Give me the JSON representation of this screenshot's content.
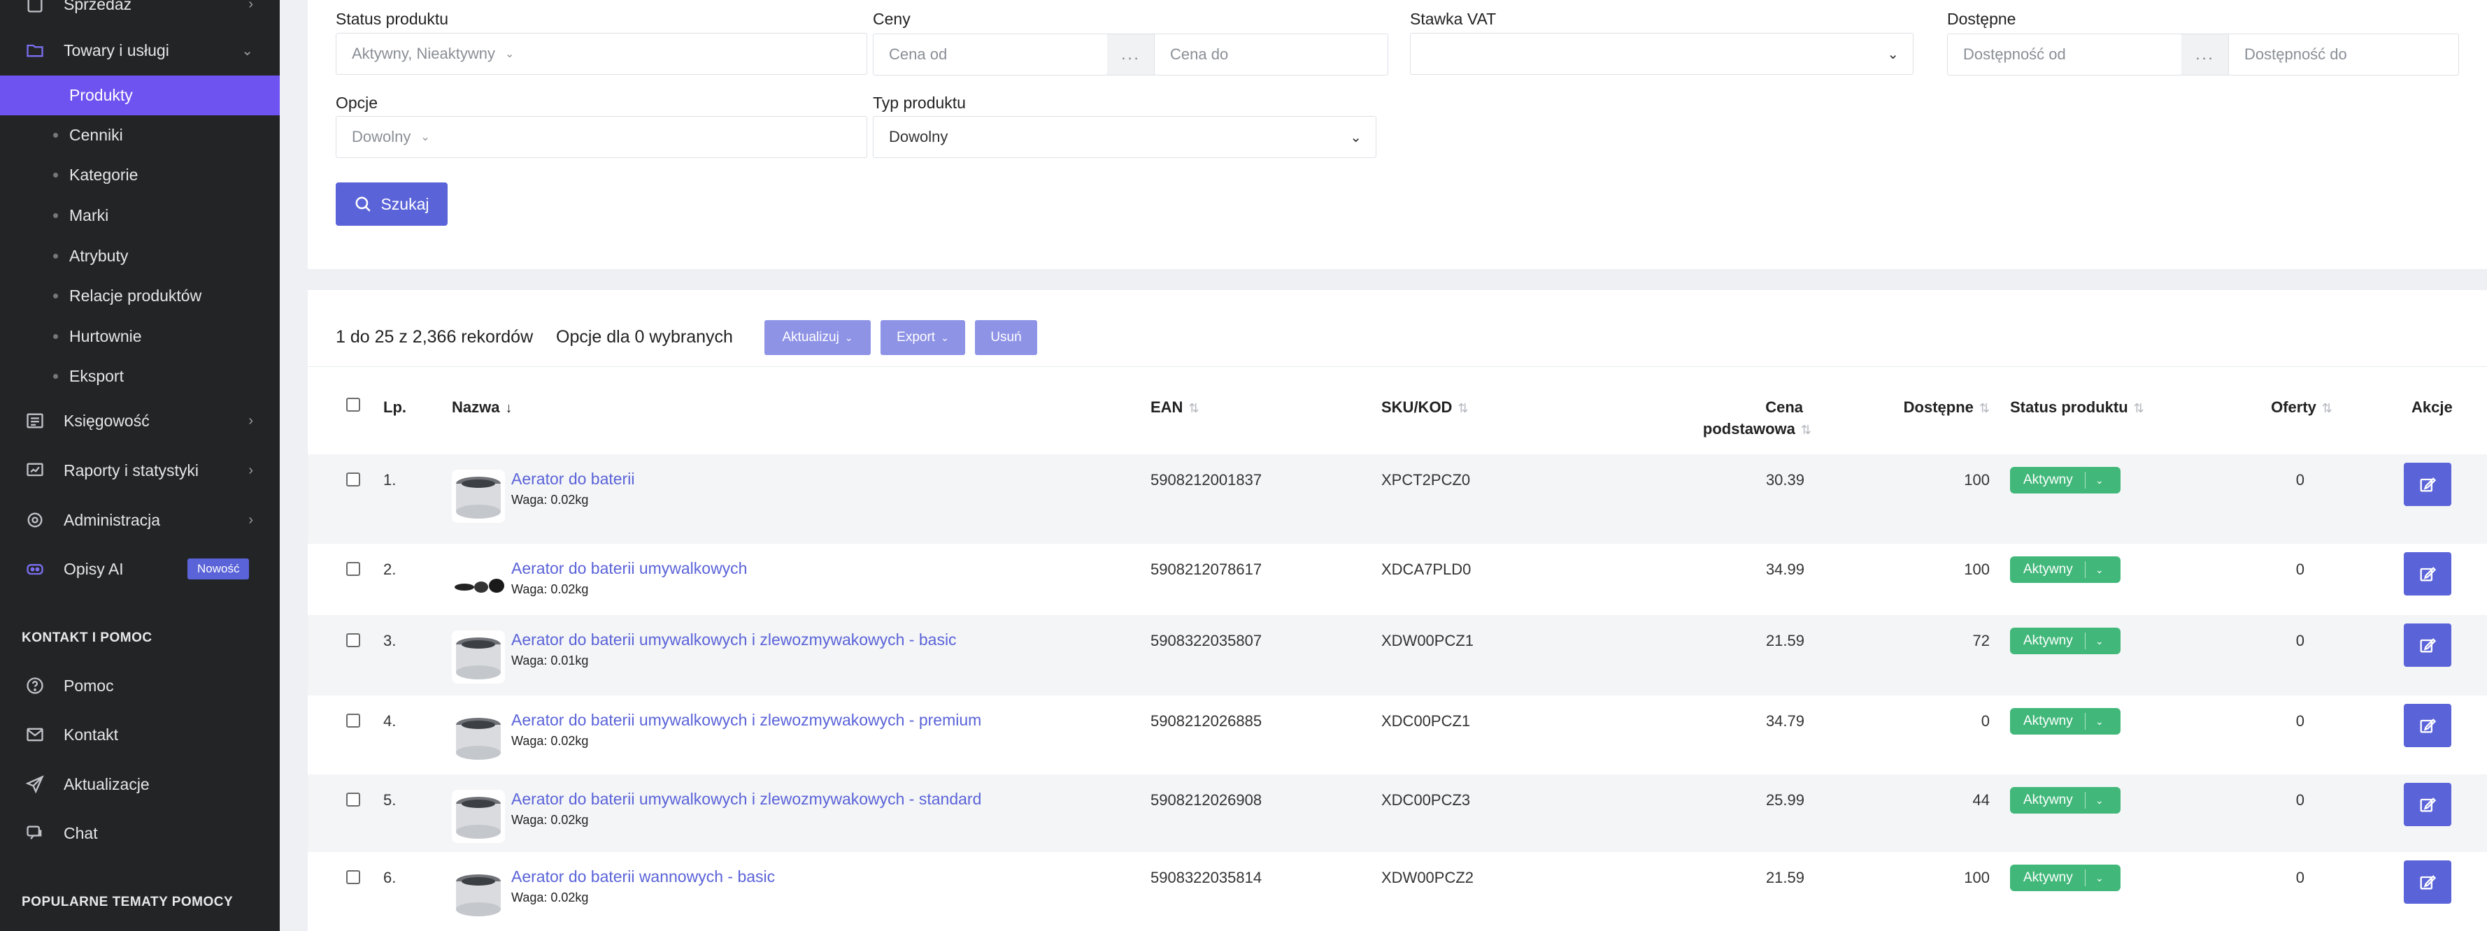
{
  "sidebar": {
    "top_cut_label": "Sprzedaż",
    "towary": "Towary i usługi",
    "subitems": [
      "Produkty",
      "Cenniki",
      "Kategorie",
      "Marki",
      "Atrybuty",
      "Relacje produktów",
      "Hurtownie",
      "Eksport"
    ],
    "ksiegowosc": "Księgowość",
    "raporty": "Raporty i statystyki",
    "administracja": "Administracja",
    "opisy": "Opisy AI",
    "opisy_badge": "Nowość",
    "section_kontakt": "KONTAKT I POMOC",
    "pomoc": "Pomoc",
    "kontakt": "Kontakt",
    "aktualizacje": "Aktualizacje",
    "chat": "Chat",
    "section_popularne": "POPULARNE TEMATY POMOCY"
  },
  "filters": {
    "status_label": "Status produktu",
    "status_value": "Aktywny, Nieaktywny",
    "ceny_label": "Ceny",
    "cena_od": "Cena od",
    "cena_do": "Cena do",
    "sep": "...",
    "vat_label": "Stawka VAT",
    "dostepne_label": "Dostępne",
    "dost_od": "Dostępność od",
    "dost_do": "Dostępność do",
    "opcje_label": "Opcje",
    "opcje_value": "Dowolny",
    "typ_label": "Typ produktu",
    "typ_value": "Dowolny",
    "search_btn": "Szukaj"
  },
  "toolbar": {
    "records": "1 do 25 z 2,366 rekordów",
    "options": "Opcje dla 0 wybranych",
    "update": "Aktualizuj",
    "export": "Export",
    "delete": "Usuń"
  },
  "table": {
    "headers": {
      "lp": "Lp.",
      "nazwa": "Nazwa",
      "ean": "EAN",
      "sku": "SKU/KOD",
      "cena1": "Cena",
      "cena2": "podstawowa",
      "dostepne": "Dostępne",
      "status": "Status produktu",
      "oferty": "Oferty",
      "akcje": "Akcje"
    },
    "rows": [
      {
        "lp": "1.",
        "name": "Aerator do baterii",
        "weight": "Waga: 0.02kg",
        "ean": "5908212001837",
        "sku": "XPCT2PCZ0",
        "price": "30.39",
        "stock": "100",
        "status": "Aktywny",
        "offers": "0"
      },
      {
        "lp": "2.",
        "name": "Aerator do baterii umywalkowych",
        "weight": "Waga: 0.02kg",
        "ean": "5908212078617",
        "sku": "XDCA7PLD0",
        "price": "34.99",
        "stock": "100",
        "status": "Aktywny",
        "offers": "0"
      },
      {
        "lp": "3.",
        "name": "Aerator do baterii umywalkowych i zlewozmywakowych - basic",
        "weight": "Waga: 0.01kg",
        "ean": "5908322035807",
        "sku": "XDW00PCZ1",
        "price": "21.59",
        "stock": "72",
        "status": "Aktywny",
        "offers": "0"
      },
      {
        "lp": "4.",
        "name": "Aerator do baterii umywalkowych i zlewozmywakowych - premium",
        "weight": "Waga: 0.02kg",
        "ean": "5908212026885",
        "sku": "XDC00PCZ1",
        "price": "34.79",
        "stock": "0",
        "status": "Aktywny",
        "offers": "0"
      },
      {
        "lp": "5.",
        "name": "Aerator do baterii umywalkowych i zlewozmywakowych - standard",
        "weight": "Waga: 0.02kg",
        "ean": "5908212026908",
        "sku": "XDC00PCZ3",
        "price": "25.99",
        "stock": "44",
        "status": "Aktywny",
        "offers": "0"
      },
      {
        "lp": "6.",
        "name": "Aerator do baterii wannowych - basic",
        "weight": "Waga: 0.02kg",
        "ean": "5908322035814",
        "sku": "XDW00PCZ2",
        "price": "21.59",
        "stock": "100",
        "status": "Aktywny",
        "offers": "0"
      }
    ]
  }
}
